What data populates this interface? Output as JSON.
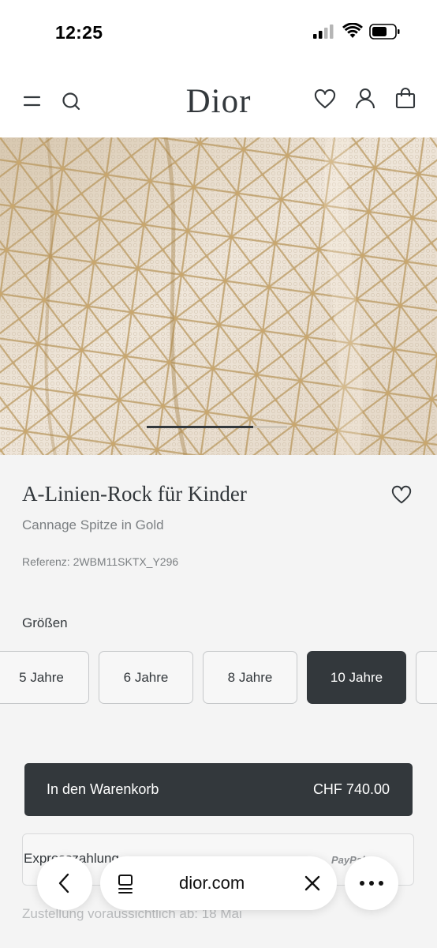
{
  "status_bar": {
    "time": "12:25"
  },
  "header": {
    "logo": "Dior"
  },
  "icons": {
    "menu": "hamburger-icon",
    "search": "search-icon",
    "wishlist": "heart-icon",
    "account": "user-icon",
    "bag": "shopping-bag-icon"
  },
  "gallery": {
    "current_progress": 0.76
  },
  "product": {
    "title": "A-Linien-Rock für Kinder",
    "subtitle": "Cannage Spitze in Gold",
    "reference": "Referenz: 2WBM11SKTX_Y296"
  },
  "sizes": {
    "label": "Größen",
    "options": [
      {
        "label": "5 Jahre",
        "selected": false
      },
      {
        "label": "6 Jahre",
        "selected": false
      },
      {
        "label": "8 Jahre",
        "selected": false
      },
      {
        "label": "10 Jahre",
        "selected": true
      }
    ]
  },
  "cart": {
    "label": "In den Warenkorb",
    "price": "CHF 740.00"
  },
  "payment": {
    "label": "Expresszahlung",
    "provider": "PayPal"
  },
  "delivery": {
    "text": "Zustellung voraussichtlich ab: 18 Mai"
  },
  "browser": {
    "url": "dior.com"
  },
  "colors": {
    "primary": "#33383c",
    "background": "#f4f4f4",
    "muted_text": "#7b7f82"
  }
}
